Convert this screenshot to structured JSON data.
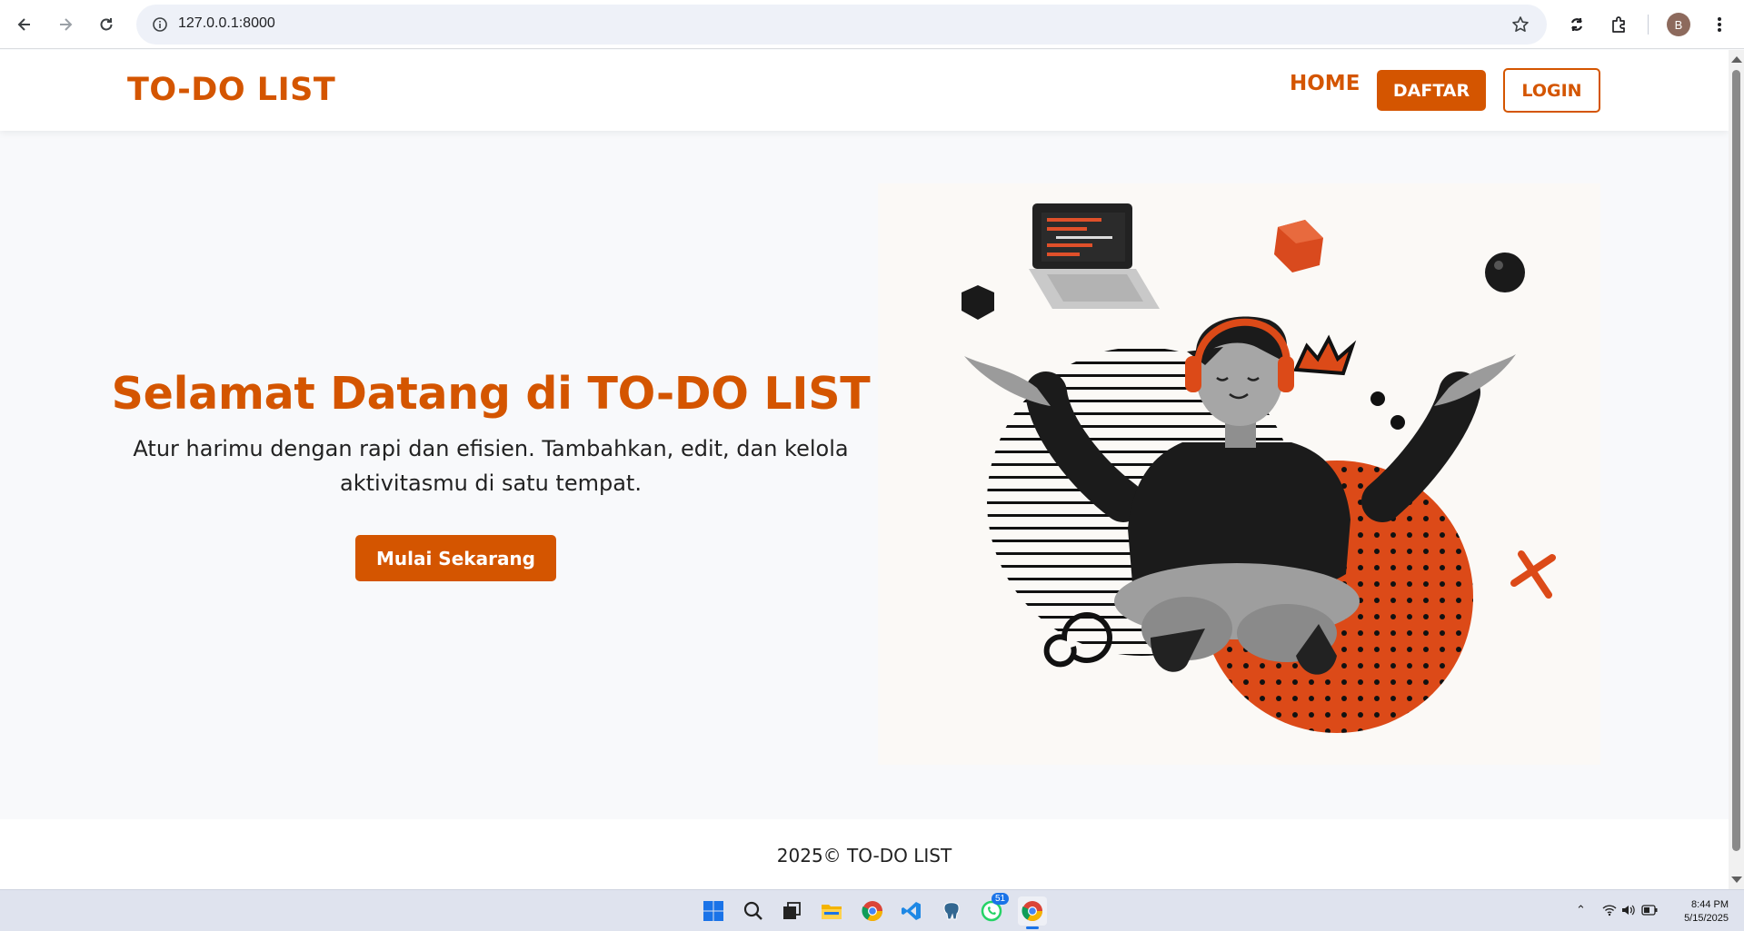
{
  "browser": {
    "url": "127.0.0.1:8000",
    "profile_initial": "B"
  },
  "header": {
    "brand": "TO-DO LIST",
    "nav_home": "HOME",
    "daftar_label": "DAFTAR",
    "login_label": "LOGIN"
  },
  "hero": {
    "title": "Selamat Datang di TO-DO LIST",
    "subtitle": "Atur harimu dengan rapi dan efisien. Tambahkan, edit, dan kelola aktivitasmu di satu tempat.",
    "cta_label": "Mulai Sekarang"
  },
  "footer": {
    "text": "2025© TO-DO LIST"
  },
  "taskbar": {
    "time": "8:44 PM",
    "date": "5/15/2025",
    "whatsapp_badge": "51"
  },
  "colors": {
    "accent": "#d45500",
    "page_bg": "#f8f9fb"
  },
  "icons": [
    "back-icon",
    "forward-icon",
    "reload-icon",
    "site-info-icon",
    "star-icon",
    "sync-icon",
    "extensions-icon",
    "menu-icon"
  ]
}
